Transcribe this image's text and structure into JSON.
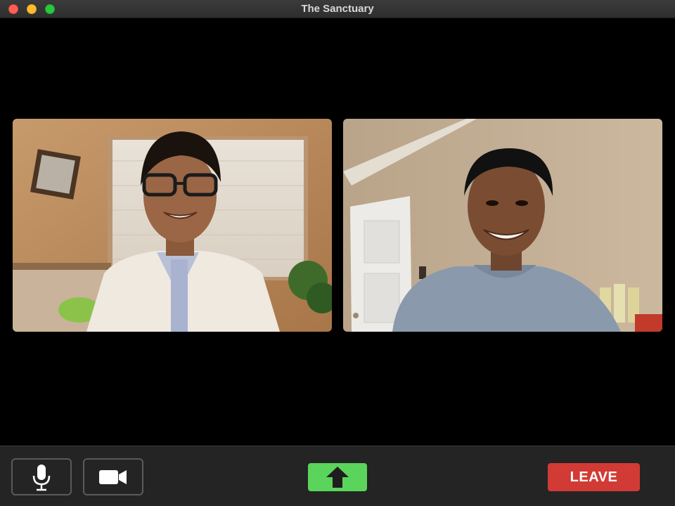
{
  "window": {
    "title": "The Sanctuary"
  },
  "participants": [
    {
      "icon": "participant-video-feed",
      "position": "left"
    },
    {
      "icon": "participant-video-feed",
      "position": "right"
    }
  ],
  "controls": {
    "mic_icon": "microphone-icon",
    "camera_icon": "video-camera-icon",
    "share_icon": "up-arrow-icon",
    "leave_label": "LEAVE"
  },
  "colors": {
    "share_button": "#5bd45b",
    "leave_button": "#d23b35",
    "control_bar": "#242424"
  }
}
